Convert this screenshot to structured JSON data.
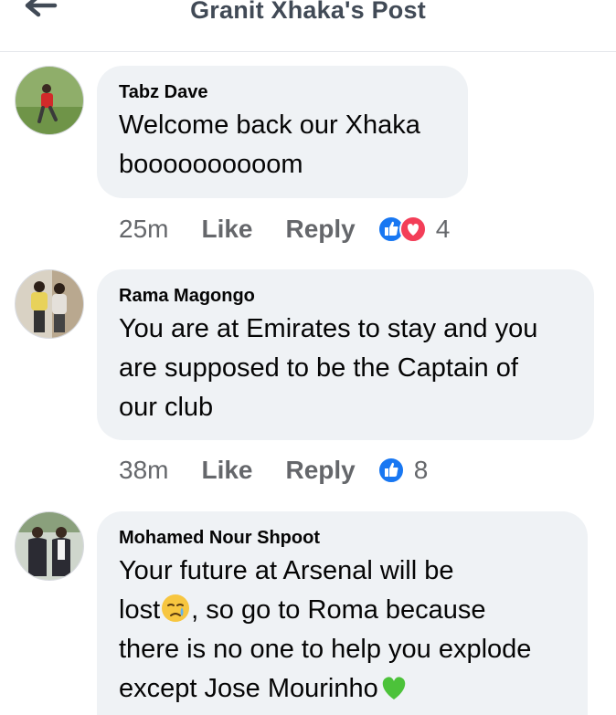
{
  "header": {
    "title": "Granit Xhaka's Post"
  },
  "colors": {
    "like_blue": "#1877f2",
    "love_red": "#f33e58",
    "bubble_bg": "#eff2f5",
    "meta_gray": "#65676b"
  },
  "comments": [
    {
      "author": "Tabz Dave",
      "lines": [
        "Welcome back our Xhaka",
        "boooooooooom"
      ],
      "time": "25m",
      "like_label": "Like",
      "reply_label": "Reply",
      "reactions": [
        "like-icon",
        "love-icon"
      ],
      "reaction_count": "4"
    },
    {
      "author": "Rama Magongo",
      "lines": [
        "You are at Emirates to stay and you",
        "are supposed to be the Captain of",
        "our club"
      ],
      "time": "38m",
      "like_label": "Like",
      "reply_label": "Reply",
      "reactions": [
        "like-icon"
      ],
      "reaction_count": "8"
    },
    {
      "author": "Mohamed Nour Shpoot",
      "lines": [
        "Your future at Arsenal will be",
        "lost",
        ", so go to Roma because",
        "there is no one to help you explode",
        "except Jose Mourinho"
      ],
      "emojis": [
        "crying-face-emoji",
        "green-heart-emoji"
      ]
    }
  ]
}
